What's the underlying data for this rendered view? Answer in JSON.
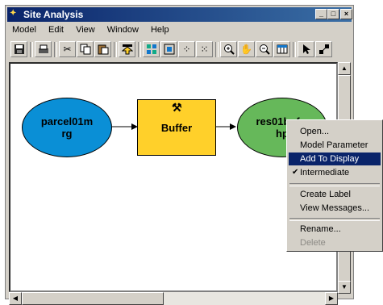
{
  "window": {
    "title": "Site Analysis",
    "min": "_",
    "max": "□",
    "close": "×"
  },
  "menu": [
    "Model",
    "Edit",
    "View",
    "Window",
    "Help"
  ],
  "toolbar": {
    "icons": [
      "save-icon",
      "print-icon",
      "cut-icon",
      "copy-icon",
      "paste-icon",
      "add-data-icon",
      "select-all-icon",
      "full-extent-icon",
      "zoom-in-fixed-icon",
      "zoom-out-fixed-icon",
      "zoom-in-icon",
      "pan-icon",
      "zoom-out-icon",
      "table-icon",
      "pointer-icon",
      "connect-icon"
    ]
  },
  "model": {
    "input": {
      "label": "parcel01m rg",
      "color": "#0a8fd6"
    },
    "tool": {
      "label": "Buffer",
      "color": "#ffd02a",
      "icon": "hammer-icon"
    },
    "output": {
      "label": "res01buf.s hp",
      "color": "#66b85a"
    }
  },
  "context_menu": {
    "items": [
      {
        "label": "Open...",
        "state": "normal"
      },
      {
        "label": "Model Parameter",
        "state": "normal"
      },
      {
        "label": "Add To Display",
        "state": "highlighted"
      },
      {
        "label": "Intermediate",
        "state": "checked"
      },
      {
        "label": "Create Label",
        "state": "normal"
      },
      {
        "label": "View Messages...",
        "state": "normal"
      },
      {
        "label": "Rename...",
        "state": "normal"
      },
      {
        "label": "Delete",
        "state": "disabled"
      }
    ]
  }
}
